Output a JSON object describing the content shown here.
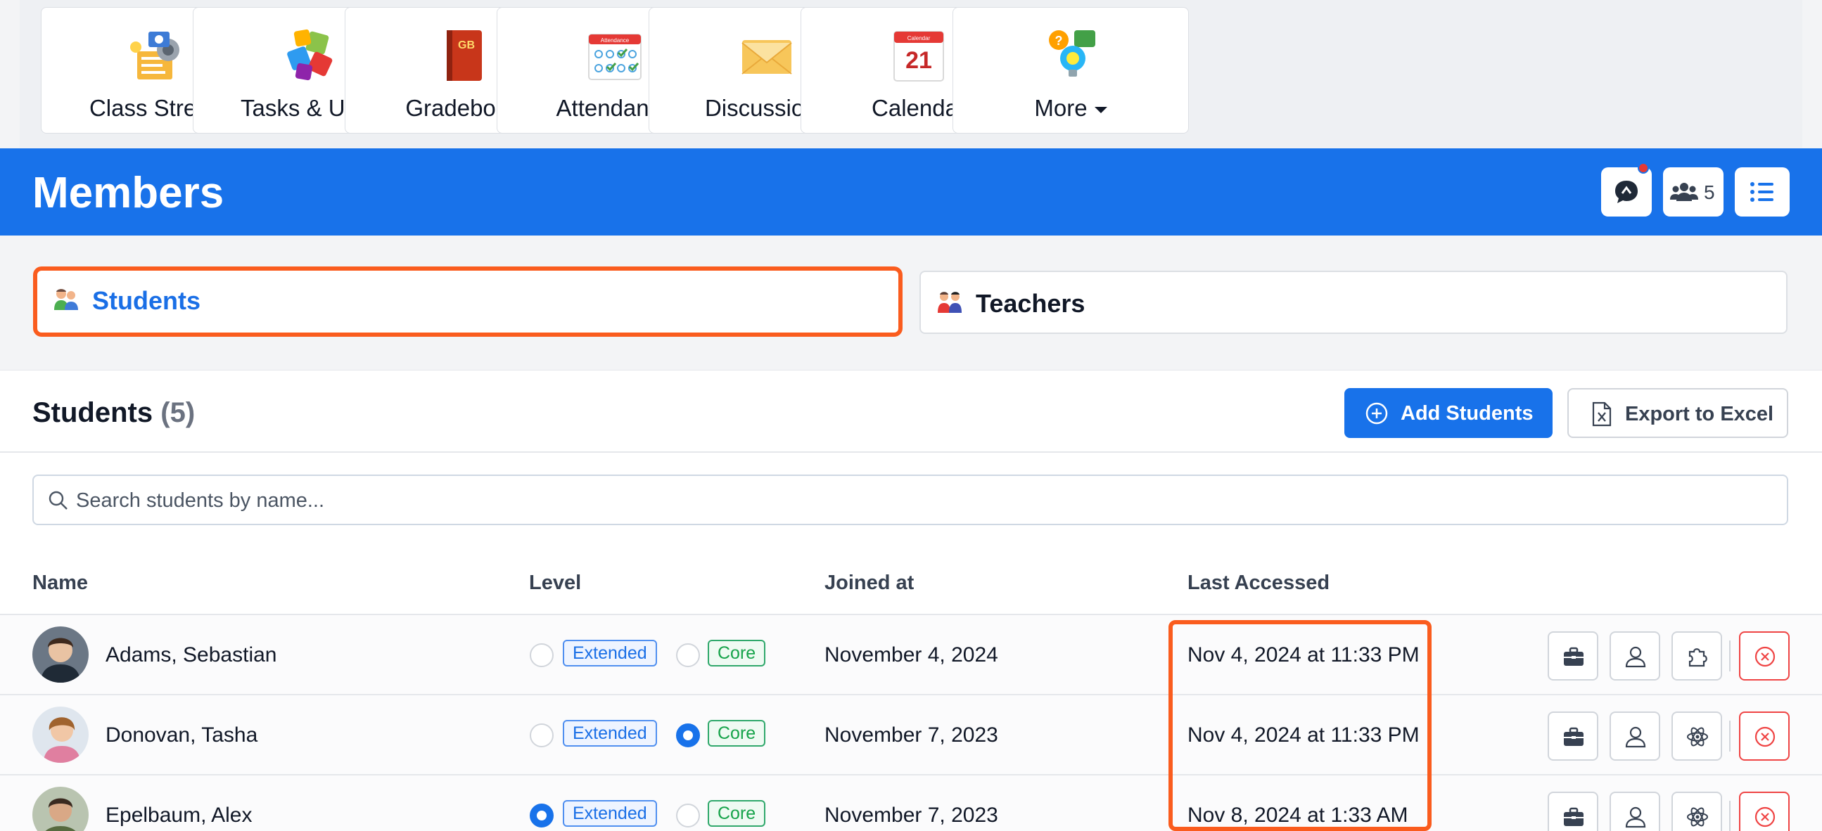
{
  "nav": {
    "tiles": [
      {
        "label": "Class Stream",
        "icon": "class-stream-icon"
      },
      {
        "label": "Tasks & Units",
        "icon": "puzzle-icon"
      },
      {
        "label": "Gradebook",
        "icon": "gradebook-icon",
        "icon_text": "GB"
      },
      {
        "label": "Attendance",
        "icon": "attendance-icon",
        "icon_text": "Attendance"
      },
      {
        "label": "Discussions",
        "icon": "envelope-icon"
      },
      {
        "label": "Calendar",
        "icon": "calendar-icon",
        "icon_text": "Calendar",
        "icon_day": "21"
      },
      {
        "label": "More",
        "icon": "more-icon"
      }
    ]
  },
  "header": {
    "title": "Members",
    "member_count": "5",
    "accent_color": "#1872ea"
  },
  "tabs": {
    "students": "Students",
    "teachers": "Teachers",
    "active": "Students"
  },
  "section": {
    "title": "Students",
    "count": "(5)",
    "add_button": "Add Students",
    "export_button": "Export to Excel"
  },
  "search": {
    "placeholder": "Search students by name..."
  },
  "table": {
    "columns": [
      "Name",
      "Level",
      "Joined at",
      "Last Accessed"
    ],
    "level_options": [
      "Extended",
      "Core"
    ],
    "rows": [
      {
        "name": "Adams, Sebastian",
        "level": "",
        "joined": "November 4, 2024",
        "last_accessed": "Nov 4, 2024 at 11:33 PM"
      },
      {
        "name": "Donovan, Tasha",
        "level": "Core",
        "joined": "November 7, 2023",
        "last_accessed": "Nov 4, 2024 at 11:33 PM"
      },
      {
        "name": "Epelbaum, Alex",
        "level": "Extended",
        "joined": "November 7, 2023",
        "last_accessed": "Nov 8, 2024 at 1:33 AM"
      }
    ]
  },
  "colors": {
    "highlight": "#fa5c1e",
    "extended": "#1a6fe6",
    "core": "#16a34a",
    "remove": "#ef4444"
  }
}
